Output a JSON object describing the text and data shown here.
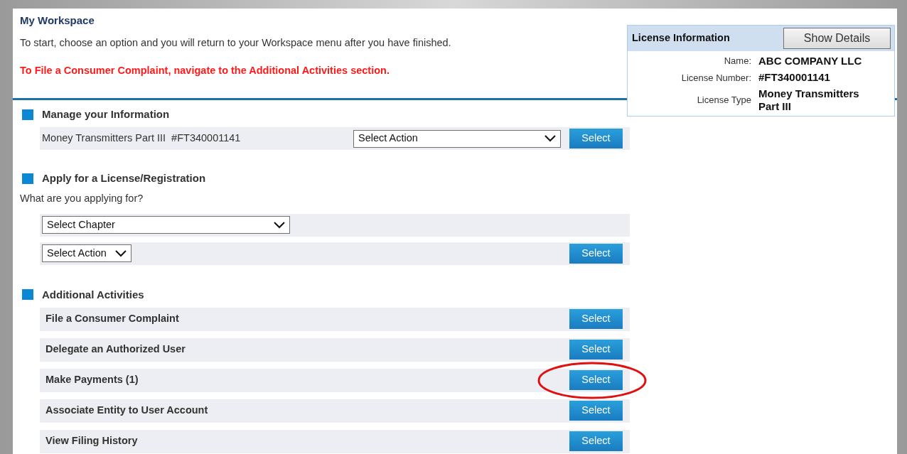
{
  "header": {
    "title": "My Workspace",
    "intro": "To start, choose an option and you will return to your Workspace menu after you have finished.",
    "notice": "To File a Consumer Complaint, navigate to the Additional Activities section."
  },
  "license_info": {
    "title": "License Information",
    "button": "Show Details",
    "fields": [
      {
        "label": "Name:",
        "value": "ABC COMPANY LLC"
      },
      {
        "label": "License Number:",
        "value": "#FT340001141"
      },
      {
        "label": "License Type",
        "value": "Money Transmitters Part III"
      }
    ]
  },
  "manage": {
    "title": "Manage your Information",
    "license": "Money Transmitters Part III  #FT340001141",
    "select": "Select Action",
    "button": "Select"
  },
  "apply": {
    "title": "Apply for a License/Registration",
    "question": "What are you applying for?",
    "chapter_select": "Select Chapter",
    "action_select": "Select Action",
    "button": "Select"
  },
  "activities": {
    "title": "Additional Activities",
    "items": [
      {
        "label": "File a Consumer Complaint",
        "button": "Select",
        "highlighted": false
      },
      {
        "label": "Delegate an Authorized User",
        "button": "Select",
        "highlighted": false
      },
      {
        "label": "Make Payments (1)",
        "button": "Select",
        "highlighted": true
      },
      {
        "label": "Associate Entity to User Account",
        "button": "Select",
        "highlighted": false
      },
      {
        "label": "View Filing History",
        "button": "Select",
        "highlighted": false
      }
    ]
  }
}
